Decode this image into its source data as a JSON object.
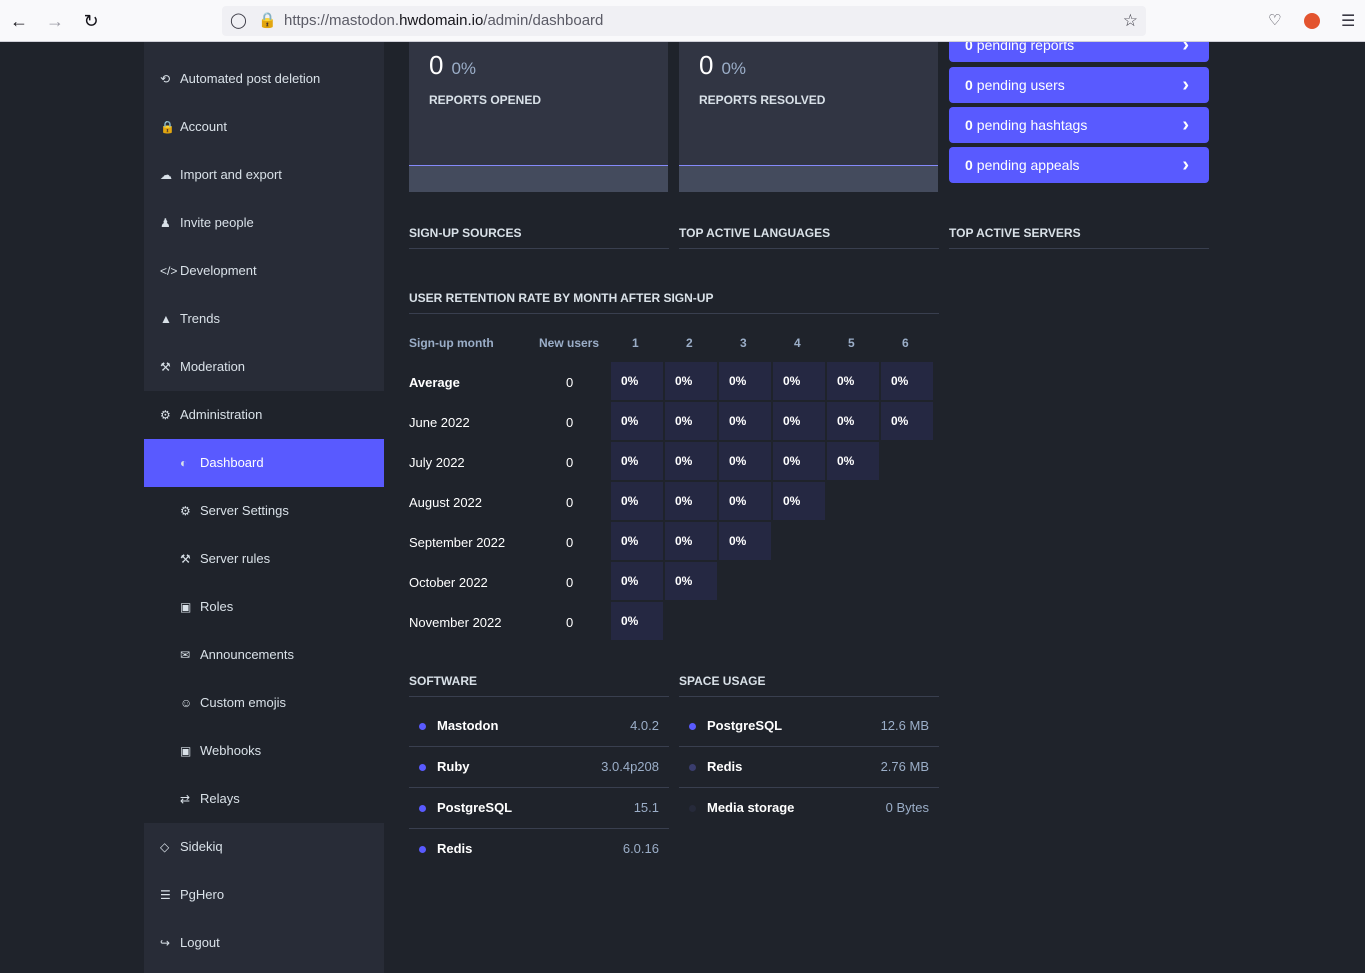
{
  "browser": {
    "url_prefix": "https://mastodon.",
    "url_domain": "hwdomain.io",
    "url_path": "/admin/dashboard"
  },
  "sidebar": {
    "items": [
      {
        "label": "Automated post deletion",
        "icon": "history-icon"
      },
      {
        "label": "Account",
        "icon": "lock-icon"
      },
      {
        "label": "Import and export",
        "icon": "cloud-download-icon"
      },
      {
        "label": "Invite people",
        "icon": "user-plus-icon"
      },
      {
        "label": "Development",
        "icon": "code-icon"
      },
      {
        "label": "Trends",
        "icon": "fire-icon"
      },
      {
        "label": "Moderation",
        "icon": "gavel-icon"
      },
      {
        "label": "Administration",
        "icon": "cogs-icon"
      }
    ],
    "subitems": [
      {
        "label": "Dashboard",
        "icon": "tachometer-icon",
        "active": true
      },
      {
        "label": "Server Settings",
        "icon": "cogs-icon"
      },
      {
        "label": "Server rules",
        "icon": "gavel-icon"
      },
      {
        "label": "Roles",
        "icon": "id-card-icon"
      },
      {
        "label": "Announcements",
        "icon": "bullhorn-icon"
      },
      {
        "label": "Custom emojis",
        "icon": "smile-icon"
      },
      {
        "label": "Webhooks",
        "icon": "inbox-icon"
      },
      {
        "label": "Relays",
        "icon": "exchange-icon"
      }
    ],
    "bottom": [
      {
        "label": "Sidekiq",
        "icon": "diamond-icon"
      },
      {
        "label": "PgHero",
        "icon": "database-icon"
      },
      {
        "label": "Logout",
        "icon": "sign-out-icon"
      }
    ]
  },
  "cards": [
    {
      "value": "0",
      "percent": "0%",
      "label": "REPORTS OPENED"
    },
    {
      "value": "0",
      "percent": "0%",
      "label": "REPORTS RESOLVED"
    }
  ],
  "pending": [
    {
      "count": "0",
      "text": "pending reports"
    },
    {
      "count": "0",
      "text": "pending users"
    },
    {
      "count": "0",
      "text": "pending hashtags"
    },
    {
      "count": "0",
      "text": "pending appeals"
    }
  ],
  "sections": {
    "signup_sources": "SIGN-UP SOURCES",
    "top_languages": "TOP ACTIVE LANGUAGES",
    "top_servers": "TOP ACTIVE SERVERS",
    "retention": "USER RETENTION RATE BY MONTH AFTER SIGN-UP",
    "software": "SOFTWARE",
    "space_usage": "SPACE USAGE"
  },
  "retention": {
    "headers": [
      "Sign-up month",
      "New users",
      "1",
      "2",
      "3",
      "4",
      "5",
      "6"
    ],
    "rows": [
      {
        "month": "Average",
        "new_users": "0",
        "values": [
          "0%",
          "0%",
          "0%",
          "0%",
          "0%",
          "0%"
        ]
      },
      {
        "month": "June 2022",
        "new_users": "0",
        "values": [
          "0%",
          "0%",
          "0%",
          "0%",
          "0%",
          "0%"
        ]
      },
      {
        "month": "July 2022",
        "new_users": "0",
        "values": [
          "0%",
          "0%",
          "0%",
          "0%",
          "0%"
        ]
      },
      {
        "month": "August 2022",
        "new_users": "0",
        "values": [
          "0%",
          "0%",
          "0%",
          "0%"
        ]
      },
      {
        "month": "September 2022",
        "new_users": "0",
        "values": [
          "0%",
          "0%",
          "0%"
        ]
      },
      {
        "month": "October 2022",
        "new_users": "0",
        "values": [
          "0%",
          "0%"
        ]
      },
      {
        "month": "November 2022",
        "new_users": "0",
        "values": [
          "0%"
        ]
      }
    ]
  },
  "software": [
    {
      "name": "Mastodon",
      "value": "4.0.2"
    },
    {
      "name": "Ruby",
      "value": "3.0.4p208"
    },
    {
      "name": "PostgreSQL",
      "value": "15.1"
    },
    {
      "name": "Redis",
      "value": "6.0.16"
    }
  ],
  "space_usage": [
    {
      "name": "PostgreSQL",
      "value": "12.6 MB",
      "dot_color": "#595aff"
    },
    {
      "name": "Redis",
      "value": "2.76 MB",
      "dot_color": "#3a3d6e"
    },
    {
      "name": "Media storage",
      "value": "0 Bytes",
      "dot_color": "#262a3a"
    }
  ],
  "colors": {
    "accent": "#595aff",
    "sidebar_bg": "#282c37",
    "page_bg": "#1f232b"
  }
}
